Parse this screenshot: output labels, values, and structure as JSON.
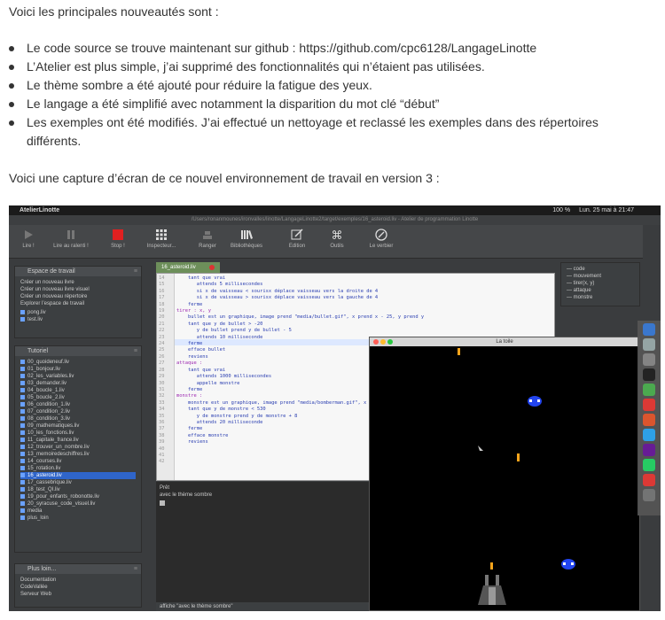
{
  "intro": "Voici les principales nouveautés sont :",
  "bullets": [
    "Le code source se trouve maintenant sur github : https://github.com/cpc6128/LangageLinotte",
    "L’Atelier est plus simple, j’ai supprimé des fonctionnalités qui n’étaient pas utilisées.",
    "Le thème sombre a été ajouté pour réduire la fatigue des yeux.",
    "Le langage a été simplifié avec notamment la disparition du mot clé “début”",
    "Les exemples ont été modifiés. J’ai effectué un nettoyage et reclassé les exemples dans des répertoires différents."
  ],
  "outro": "Voici une capture d’écran de ce nouvel environnement de travail en version 3 :",
  "screenshot": {
    "menubar": {
      "app": "AtelierLinotte",
      "battery": "100 %",
      "datetime": "Lun. 25 mai à 21:47"
    },
    "title": "/Users/ronanmounes/ironvalles/linotte/LangageLinotte2/target/exemples/16_asteroid.liv - Atelier de programmation Linotte",
    "toolbar": [
      "Lire !",
      "Lire au ralenti !",
      "Stop !",
      "Inspecteur...",
      "Ranger",
      "Bibliothèques",
      "Edition",
      "Outils",
      "Le verbier"
    ],
    "espace": {
      "title": "Espace de travail",
      "actions": [
        "Créer un nouveau livre",
        "Créer un nouveau livre visuel",
        "Créer un nouveau répertoire",
        "Explorer l’espace de travail"
      ],
      "files": [
        "pong.liv",
        "test.liv"
      ]
    },
    "tutoriel": {
      "title": "Tutoriel",
      "files": [
        "00_quoideneuf.liv",
        "01_bonjour.liv",
        "02_les_variables.liv",
        "03_demander.liv",
        "04_boucle_1.liv",
        "05_boucle_2.liv",
        "06_condition_1.liv",
        "07_condition_2.liv",
        "08_condition_3.liv",
        "09_mathematiques.liv",
        "10_les_fonctions.liv",
        "11_capitale_france.liv",
        "12_trouver_un_nombre.liv",
        "13_memoiredeschiffres.liv",
        "14_courses.liv",
        "15_rotation.liv",
        "16_asteroid.liv",
        "17_cassebrique.liv",
        "18_test_QI.liv",
        "19_pour_enfants_robonotte.liv",
        "20_syracuse_code_visuel.liv",
        "media",
        "plus_loin"
      ],
      "selected": "16_asteroid.liv"
    },
    "plusloin": {
      "title": "Plus loin...",
      "items": [
        "Documentation",
        "CodeVallée",
        "Serveur Web"
      ]
    },
    "tab": "16_asteroid.liv",
    "code_lines": [
      "    tant que vrai",
      "       attends 5 millisecondes",
      "       si x de vaisseau < sourisx déplace vaisseau vers la droite de 4",
      "       si x de vaisseau > sourisx déplace vaisseau vers la gauche de 4",
      "    ferme",
      "",
      "tirer : x, y",
      "    bullet est un graphique, image prend \"media/bullet.gif\", x prend x - 25, y prend y",
      "    tant que y de bullet > -20",
      "       y de bullet prend y de bullet - 5",
      "       attends 10 milliseconde",
      "    ferme",
      "    efface bullet",
      "    reviens",
      "",
      "attaque :",
      "    tant que vrai",
      "       attends 1000 millisecondes",
      "       appelle monstre",
      "    ferme",
      "",
      "monstre :",
      "    monstre est un graphique, image prend \"media/bomberman.gif\", x prend",
      "    tant que y de monstre < 530",
      "       y de monstre prend y de monstre + 8",
      "       attends 20 milliseconde",
      "    ferme",
      "    efface monstre",
      "    reviens"
    ],
    "line_numbers": [
      "14",
      "15",
      "16",
      "17",
      "18",
      "19",
      "20",
      "21",
      "22",
      "23",
      "24",
      "25",
      "26",
      "27",
      "28",
      "29",
      "30",
      "31",
      "32",
      "33",
      "34",
      "35",
      "36",
      "37",
      "38",
      "39",
      "40",
      "41",
      "42"
    ],
    "outline": [
      "code",
      "mouvement",
      "tirer(x, y)",
      "attaque",
      "monstre"
    ],
    "console": {
      "line1": "Prêt",
      "line2": "avec le thème sombre",
      "input": "affiche \"avec le thème sombre\""
    },
    "game_title": "La toile"
  }
}
